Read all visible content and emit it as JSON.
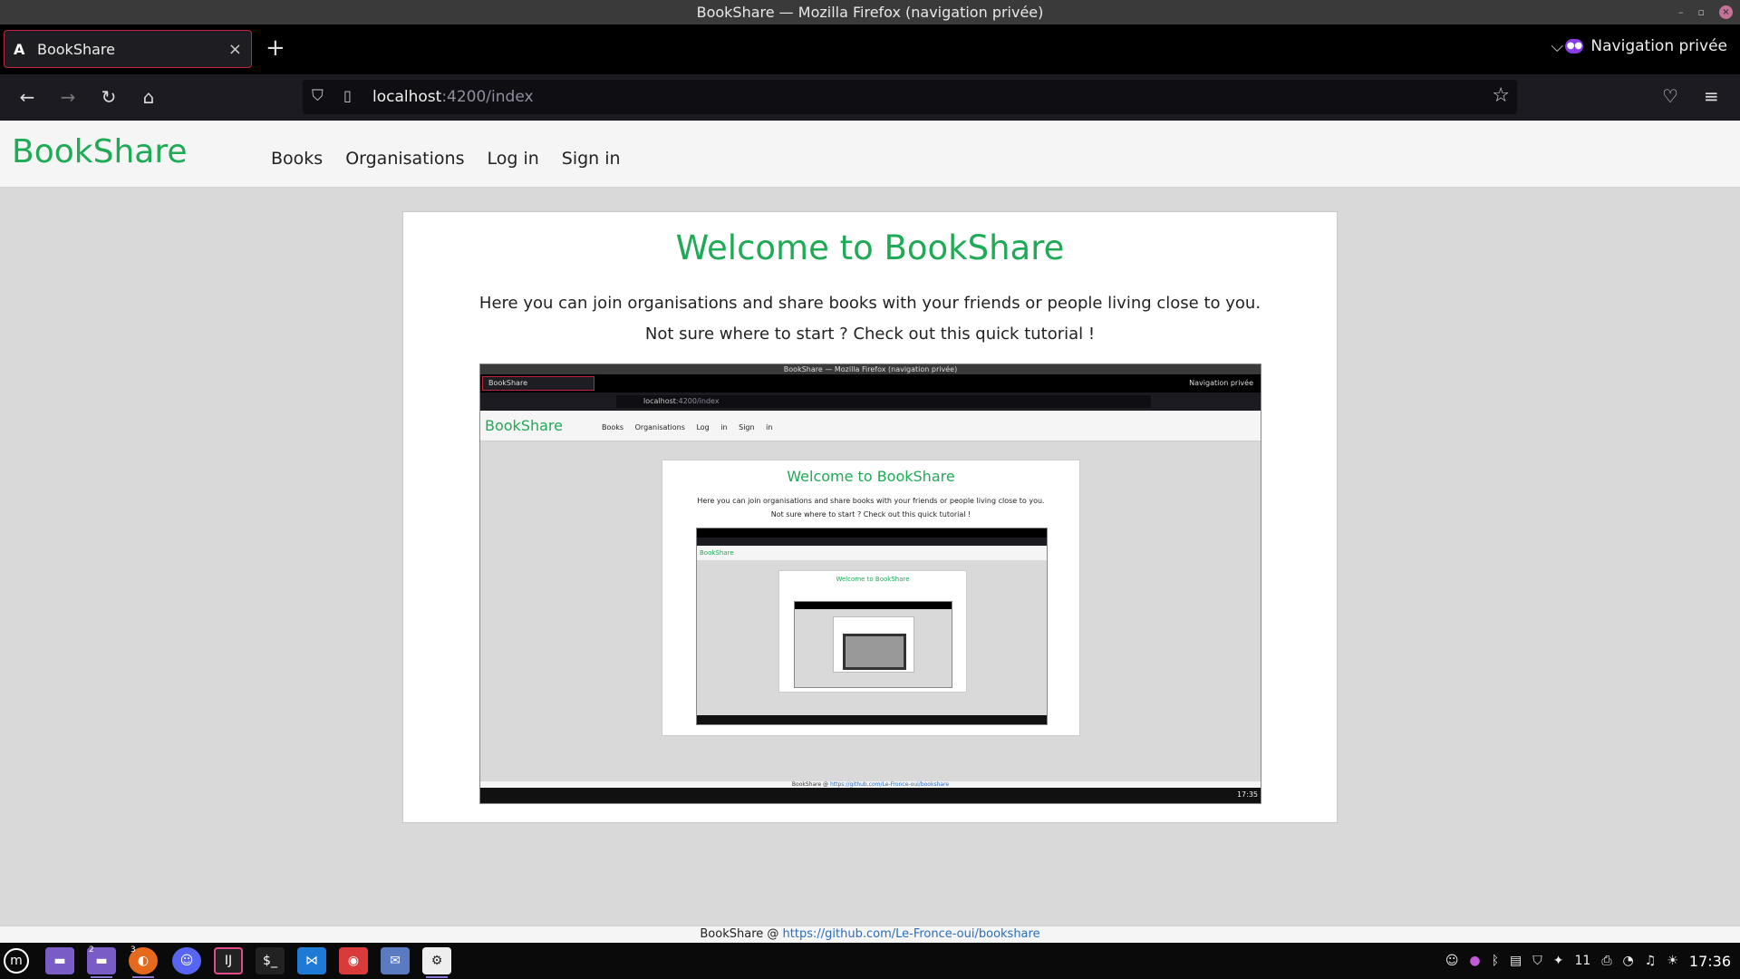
{
  "window": {
    "title": "BookShare — Mozilla Firefox (navigation privée)"
  },
  "tabs": [
    {
      "title": "BookShare",
      "favicon": "A"
    }
  ],
  "private_label": "Navigation privée",
  "urlbar": {
    "host": "localhost",
    "path": ":4200/index"
  },
  "app": {
    "brand": "BookShare",
    "nav": [
      "Books",
      "Organisations",
      "Log in",
      "Sign in"
    ]
  },
  "main": {
    "heading": "Welcome to BookShare",
    "intro": "Here you can join organisations and share books with your friends or people living close to you.",
    "tutorial_prompt": "Not sure where to start ? Check out this quick tutorial !"
  },
  "tutorial_screenshot": {
    "window_title": "BookShare — Mozilla Firefox (navigation privée)",
    "tab_title": "BookShare",
    "private_label": "Navigation privée",
    "url_host": "localhost",
    "url_path": ":4200/index",
    "brand": "BookShare",
    "nav_text": "Books Organisations Log in Sign in",
    "heading": "Welcome to BookShare",
    "intro": "Here you can join organisations and share books with your friends or people living close to you.",
    "tutorial_prompt": "Not sure where to start ? Check out this quick tutorial !",
    "footer_prefix": "BookShare @",
    "footer_link": "https://github.com/Le-Fronce-oui/bookshare",
    "clock": "17:35"
  },
  "footer": {
    "prefix": "BookShare @",
    "link": "https://github.com/Le-Fronce-oui/bookshare"
  },
  "taskbar": {
    "apps": [
      "menu-icon",
      "files-icon",
      "files-icon",
      "firefox-icon",
      "discord-icon",
      "intellij-icon",
      "terminal-icon",
      "vscode-icon",
      "git-icon",
      "mail-icon",
      "settings-icon"
    ],
    "badges": {
      "files": "2",
      "firefox": "3"
    },
    "tray_count": "11",
    "clock": "17:36"
  },
  "colors": {
    "brand_green": "#1faa55",
    "link_blue": "#2a6ebb",
    "tab_border": "#c0263b"
  }
}
